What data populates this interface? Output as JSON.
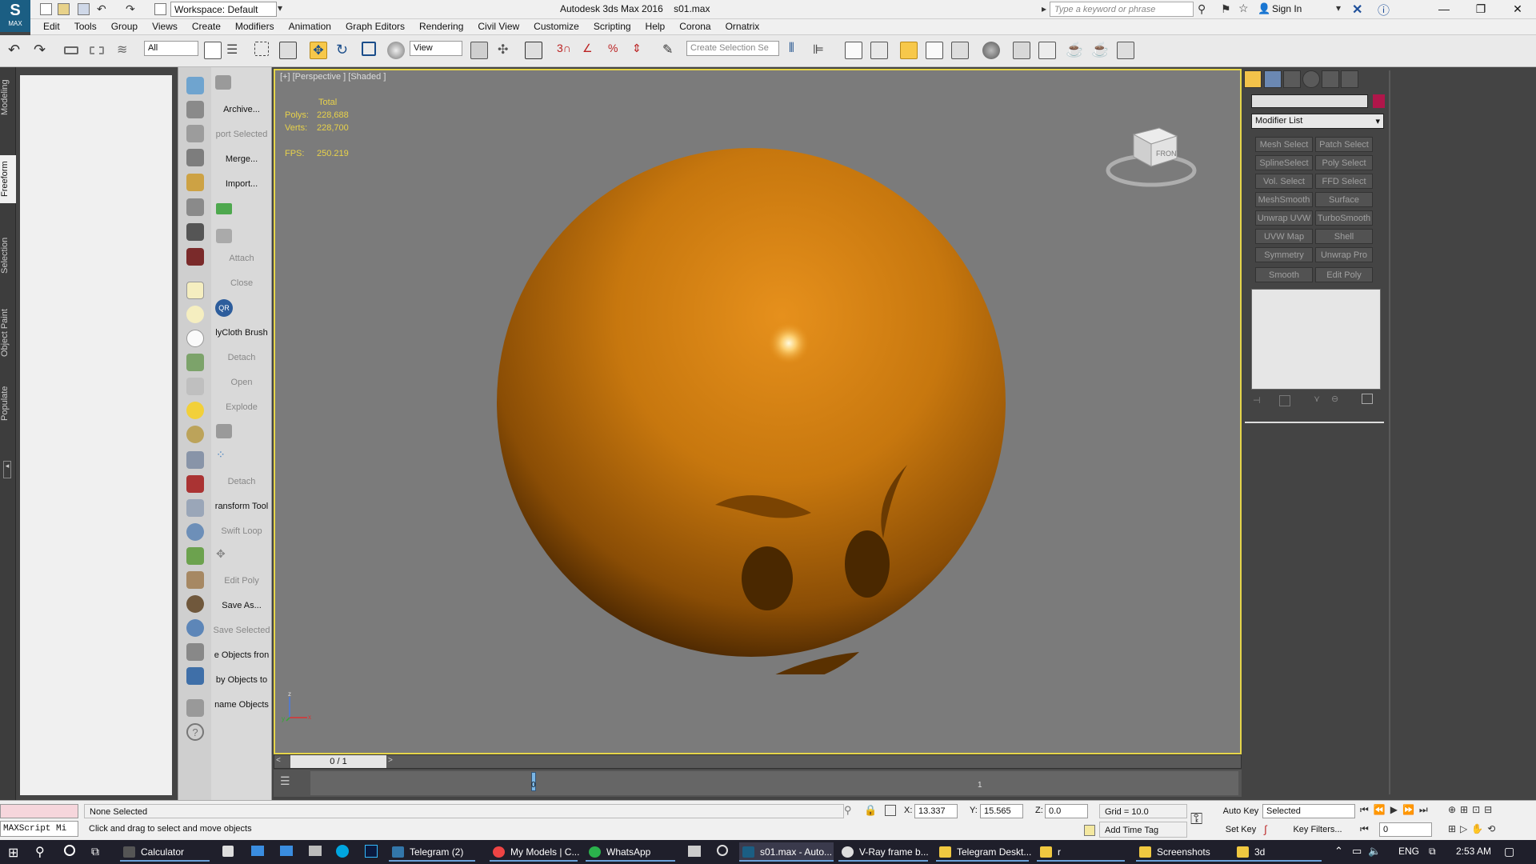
{
  "app": {
    "title": "Autodesk 3ds Max 2016",
    "file": "s01.max",
    "logo_text": "MAX",
    "workspace": "Workspace: Default",
    "search_placeholder": "Type a keyword or phrase",
    "sign_in": "Sign In"
  },
  "menu": [
    "Edit",
    "Tools",
    "Group",
    "Views",
    "Create",
    "Modifiers",
    "Animation",
    "Graph Editors",
    "Rendering",
    "Civil View",
    "Customize",
    "Scripting",
    "Help",
    "Corona",
    "Ornatrix"
  ],
  "toolbar": {
    "selection_filter": "All",
    "reference_coord": "View",
    "named_selection_placeholder": "Create Selection Se"
  },
  "ribbon_tabs": [
    "Modeling",
    "Freeform",
    "Selection",
    "Object Paint",
    "Populate"
  ],
  "command_labels": [
    {
      "text": "Archive...",
      "disabled": false
    },
    {
      "text": "port Selected",
      "disabled": true
    },
    {
      "text": "Merge...",
      "disabled": false
    },
    {
      "text": "Import...",
      "disabled": false
    },
    {
      "text": "Attach",
      "disabled": true
    },
    {
      "text": "Close",
      "disabled": true
    },
    {
      "text": "lyCloth Brush",
      "disabled": false
    },
    {
      "text": "Detach",
      "disabled": true
    },
    {
      "text": "Open",
      "disabled": true
    },
    {
      "text": "Explode",
      "disabled": true
    },
    {
      "text": "Detach",
      "disabled": true
    },
    {
      "text": "ransform Tool",
      "disabled": false
    },
    {
      "text": "Swift Loop",
      "disabled": true
    },
    {
      "text": "Edit Poly",
      "disabled": true
    },
    {
      "text": "Save As...",
      "disabled": false
    },
    {
      "text": "Save Selected",
      "disabled": true
    },
    {
      "text": "e Objects fron",
      "disabled": false
    },
    {
      "text": "by Objects to",
      "disabled": false
    },
    {
      "text": "name Objects",
      "disabled": false
    }
  ],
  "viewport": {
    "label": "[+] [Perspective ] [Shaded ]",
    "stats_header": "Total",
    "polys_label": "Polys:",
    "polys": "228,688",
    "verts_label": "Verts:",
    "verts": "228,700",
    "fps_label": "FPS:",
    "fps": "250.219",
    "viewcube_face": "FRONT",
    "axis_z": "z",
    "axis_x": "x",
    "axis_y": "y"
  },
  "timeline": {
    "frame": "0 / 1",
    "tick_0": "0",
    "tick_1": "1"
  },
  "command_panel": {
    "modifier_list": "Modifier List",
    "object_color": "#b0164a",
    "modifier_buttons": [
      "Mesh Select",
      "Patch Select",
      "SplineSelect",
      "Poly Select",
      "Vol. Select",
      "FFD Select",
      "MeshSmooth",
      "Surface Select",
      "Unwrap UVW",
      "TurboSmooth",
      "UVW Map",
      "Shell",
      "Symmetry",
      "Unwrap Pro",
      "Smooth",
      "Edit Poly"
    ]
  },
  "status": {
    "selection": "None Selected",
    "prompt": "Click and drag to select and move objects",
    "maxscript": "MAXScript Mi",
    "x_label": "X:",
    "x": "13.337",
    "y_label": "Y:",
    "y": "15.565",
    "z_label": "Z:",
    "z": "0.0",
    "grid": "Grid = 10.0",
    "add_time_tag": "Add Time Tag",
    "auto_key": "Auto Key",
    "set_key": "Set Key",
    "key_mode": "Selected",
    "key_filters": "Key Filters...",
    "current_frame": "0"
  },
  "taskbar": {
    "tasks": [
      "Calculator",
      "Telegram (2)",
      "My Models | C...",
      "WhatsApp",
      "s01.max - Auto...",
      "V-Ray frame b...",
      "Telegram Deskt...",
      "r",
      "Screenshots",
      "3d"
    ],
    "lang": "ENG",
    "time": "2:53 AM"
  }
}
